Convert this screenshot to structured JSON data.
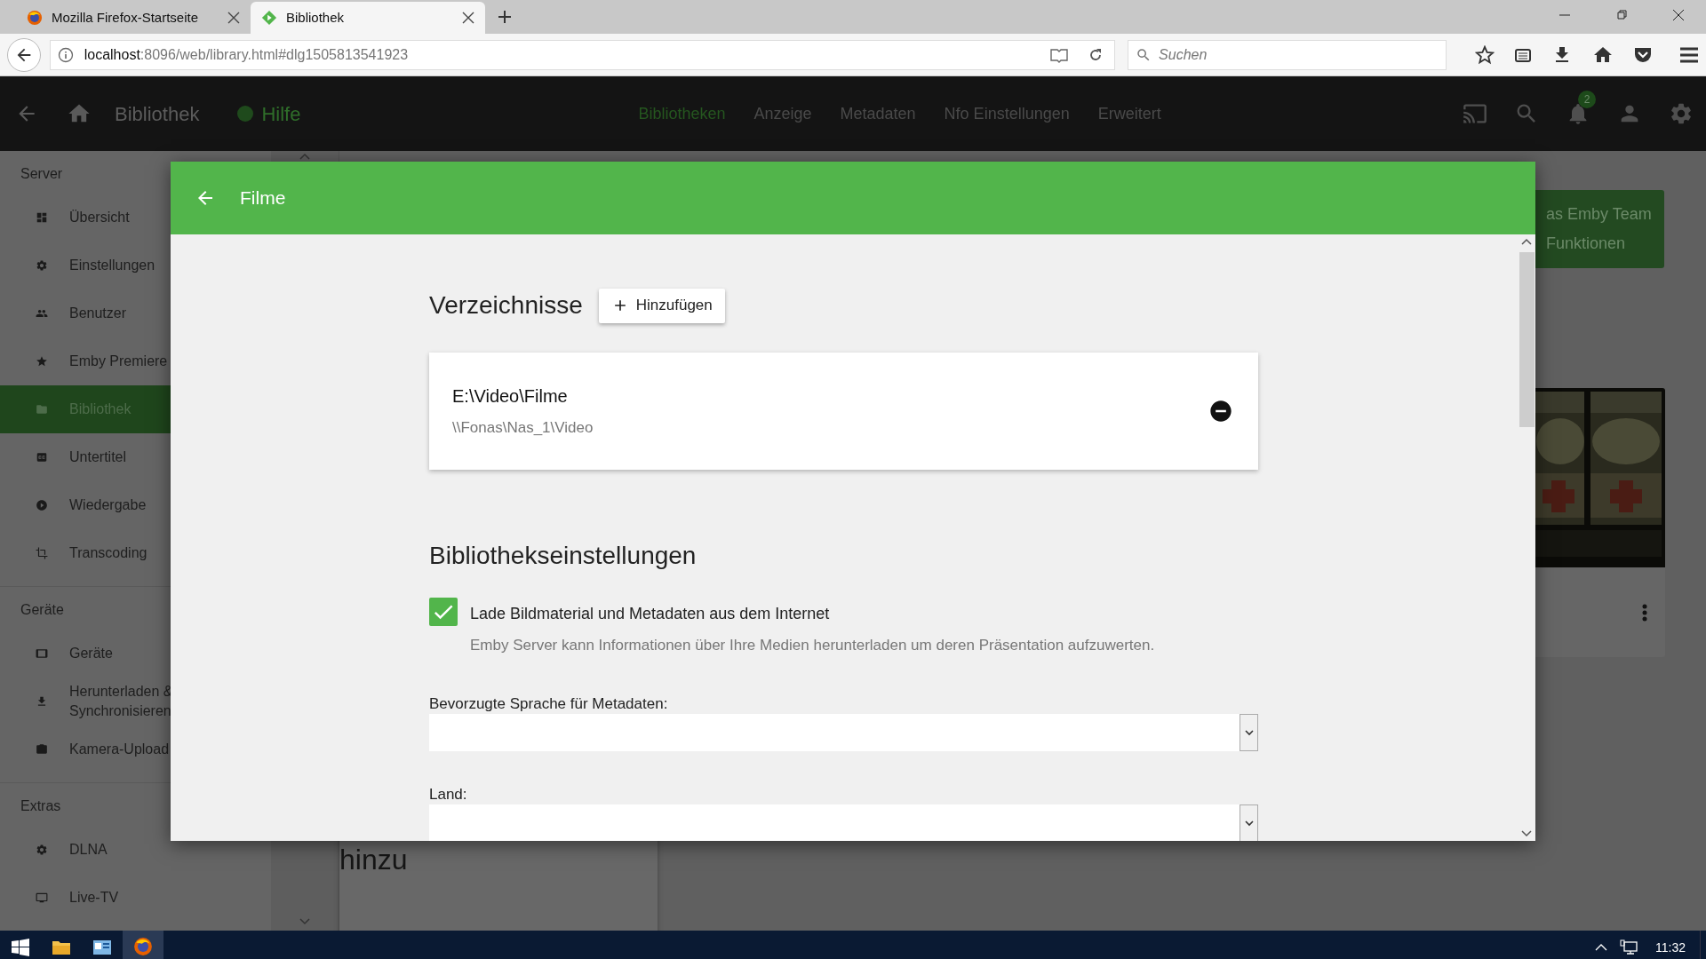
{
  "browser": {
    "tabs": [
      {
        "title": "Mozilla Firefox-Startseite",
        "kind": "browser-home",
        "selected": false
      },
      {
        "title": "Bibliothek",
        "kind": "app",
        "selected": true
      }
    ],
    "url": {
      "host": "localhost",
      "rest": ":8096/web/library.html#dlg1505813541923"
    },
    "search": {
      "placeholder": "Suchen"
    }
  },
  "app_header": {
    "title": "Bibliothek",
    "help": "Hilfe",
    "nav": [
      {
        "label": "Bibliotheken",
        "selected": true
      },
      {
        "label": "Anzeige",
        "selected": false
      },
      {
        "label": "Metadaten",
        "selected": false
      },
      {
        "label": "Nfo Einstellungen",
        "selected": false
      },
      {
        "label": "Erweitert",
        "selected": false
      }
    ],
    "notification_count": "2"
  },
  "sidebar": {
    "sections": [
      {
        "heading": "Server",
        "items": [
          {
            "label": "Übersicht",
            "kind": "dashboard",
            "selected": false
          },
          {
            "label": "Einstellungen",
            "kind": "gear",
            "selected": false
          },
          {
            "label": "Benutzer",
            "kind": "people",
            "selected": false
          },
          {
            "label": "Emby Premiere",
            "kind": "star",
            "selected": false
          },
          {
            "label": "Bibliothek",
            "kind": "folder",
            "selected": true
          },
          {
            "label": "Untertitel",
            "kind": "subtitles",
            "selected": false
          },
          {
            "label": "Wiedergabe",
            "kind": "play",
            "selected": false
          },
          {
            "label": "Transcoding",
            "kind": "crop",
            "selected": false
          }
        ]
      },
      {
        "heading": "Geräte",
        "items": [
          {
            "label": "Geräte",
            "kind": "tablet",
            "selected": false
          },
          {
            "label": "Herunterladen & Synchronisieren",
            "kind": "download",
            "selected": false
          },
          {
            "label": "Kamera-Upload",
            "kind": "camera",
            "selected": false
          }
        ]
      },
      {
        "heading": "Extras",
        "items": [
          {
            "label": "DLNA",
            "kind": "gear",
            "selected": false
          },
          {
            "label": "Live-TV",
            "kind": "tv",
            "selected": false
          }
        ]
      }
    ]
  },
  "background": {
    "banner_lines": [
      "as Emby Team",
      "Funktionen"
    ],
    "card_text": "hinzu",
    "poster": {
      "kind": "picture"
    }
  },
  "dialog": {
    "title": "Filme",
    "folders_heading": "Verzeichnisse",
    "add_button": "Hinzufügen",
    "folders": [
      {
        "path": "E:\\Video\\Filme",
        "network_path": "\\\\Fonas\\Nas_1\\Video"
      }
    ],
    "settings_heading": "Bibliothekseinstellungen",
    "checkbox": {
      "label": "Lade Bildmaterial und Metadaten aus dem Internet",
      "description": "Emby Server kann Informationen über Ihre Medien herunterladen um deren Präsentation aufzuwerten.",
      "checked": true
    },
    "fields": [
      {
        "label": "Bevorzugte Sprache für Metadaten:"
      },
      {
        "label": "Land:"
      }
    ]
  },
  "taskbar": {
    "time": "11:32"
  }
}
